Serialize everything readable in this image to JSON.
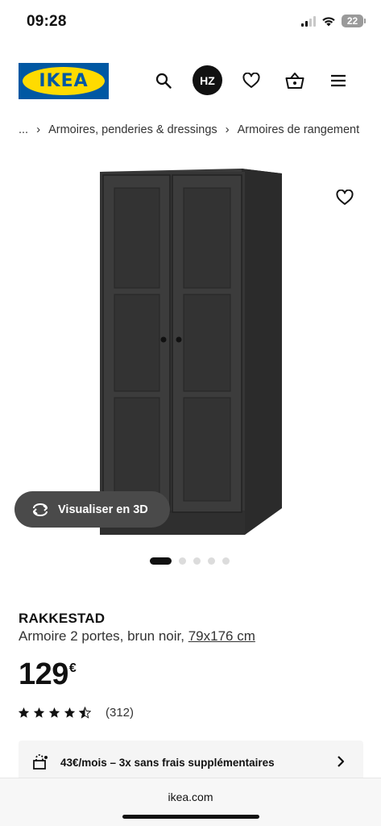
{
  "status": {
    "time": "09:28",
    "battery": "22"
  },
  "header": {
    "logo_text": "IKEA",
    "avatar_initials": "HZ",
    "brand_blue": "#0058a3",
    "brand_yellow": "#ffdb00"
  },
  "breadcrumb": {
    "items": [
      "...",
      "Armoires, penderies & dressings",
      "Armoires de rangement"
    ]
  },
  "gallery": {
    "visualise_label": "Visualiser en 3D",
    "total_images": 5,
    "active_index": 0
  },
  "product": {
    "name": "RAKKESTAD",
    "description": "Armoire 2 portes, brun noir, ",
    "measure": "79x176 cm",
    "price": "129",
    "currency": "€",
    "rating_value": 4.5,
    "rating_count": "(312)"
  },
  "payment": {
    "text": "43€/mois – 3x sans frais supplémentaires"
  },
  "browser": {
    "url": "ikea.com"
  },
  "icons": [
    "search-icon",
    "heart-icon",
    "basket-icon",
    "menu-icon",
    "rotate-3d-icon",
    "payment-icon",
    "chevron-right-icon"
  ]
}
